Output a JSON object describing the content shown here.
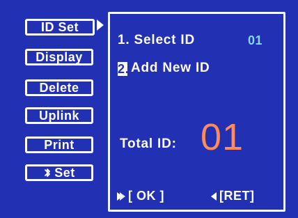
{
  "menu": {
    "items": [
      {
        "label": "ID Set"
      },
      {
        "label": "Display"
      },
      {
        "label": "Delete"
      },
      {
        "label": "Uplink"
      },
      {
        "label": "Print"
      },
      {
        "label": "Set",
        "icon": "bluetooth-icon"
      }
    ]
  },
  "panel": {
    "line1_label": "1. Select ID",
    "selected_id": "01",
    "line2_number": "2.",
    "line2_label": "Add New ID",
    "total_label": "Total ID:",
    "total_value": "01",
    "ok_label": "[ OK ]",
    "ret_label": "[RET]"
  },
  "colors": {
    "background": "#2230b4",
    "text": "#ffffff",
    "selected_id": "#87d8ff",
    "total_value": "#ff8b5b"
  }
}
